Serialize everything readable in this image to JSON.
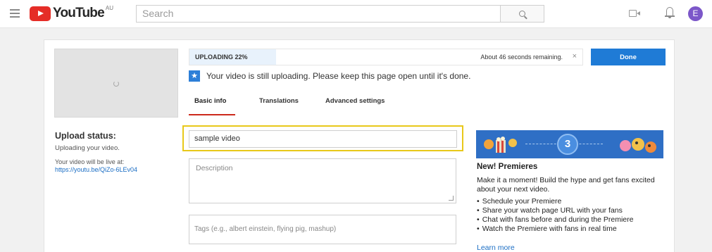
{
  "header": {
    "logo_text": "YouTube",
    "logo_region": "AU",
    "search_placeholder": "Search",
    "avatar_initial": "E"
  },
  "upload": {
    "progress_label": "UPLOADING 22%",
    "progress_fraction": 0.22,
    "remaining": "About 46 seconds remaining.",
    "cancel": "×",
    "done_label": "Done",
    "notice": "Your video is still uploading. Please keep this page open until it's done."
  },
  "tabs": [
    {
      "label": "Basic info",
      "active": true
    },
    {
      "label": "Translations",
      "active": false
    },
    {
      "label": "Advanced settings",
      "active": false
    }
  ],
  "status": {
    "title": "Upload status:",
    "sub": "Uploading your video.",
    "live_text": "Your video will be live at:",
    "link": "https://youtu.be/QiZo-6LEv04"
  },
  "form": {
    "title_value": "sample video",
    "description_placeholder": "Description",
    "tags_placeholder": "Tags (e.g., albert einstein, flying pig, mashup)"
  },
  "promo": {
    "step_number": "3",
    "title": "New! Premieres",
    "desc": "Make it a moment! Build the hype and get fans excited about your next video.",
    "items": [
      "Schedule your Premiere",
      "Share your watch page URL with your fans",
      "Chat with fans before and during the Premiere",
      "Watch the Premiere with fans in real time"
    ],
    "learn_more": "Learn more"
  },
  "colors": {
    "accent_blue": "#1f7bd6",
    "tab_underline": "#cc2a1c",
    "highlight": "#e8c81a",
    "avatar": "#7c57c9",
    "brand_red": "#e52d27"
  }
}
